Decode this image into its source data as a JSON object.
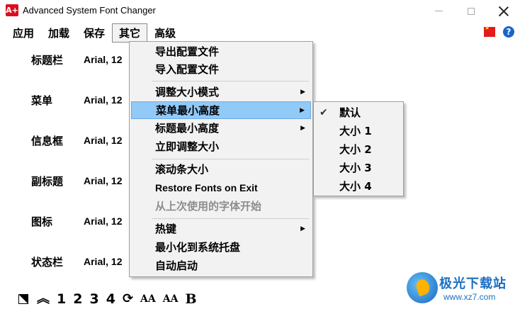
{
  "window": {
    "icon_text": "A+",
    "title": "Advanced System Font Changer"
  },
  "menubar": {
    "items": [
      "应用",
      "加载",
      "保存",
      "其它",
      "高级"
    ],
    "active_item": "其它",
    "flag_icon": "china-flag-icon",
    "help_icon_text": "?"
  },
  "settings": [
    {
      "label": "标题栏",
      "value": "Arial, 12"
    },
    {
      "label": "菜单",
      "value": "Arial, 12"
    },
    {
      "label": "信息框",
      "value": "Arial, 12"
    },
    {
      "label": "副标题",
      "value": "Arial, 12"
    },
    {
      "label": "图标",
      "value": "Arial, 12"
    },
    {
      "label": "状态栏",
      "value": "Arial, 12"
    }
  ],
  "dropdown": {
    "items": [
      {
        "label": "导出配置文件"
      },
      {
        "label": "导入配置文件"
      },
      {
        "label": "调整大小模式",
        "submenu": true
      },
      {
        "label": "菜单最小高度",
        "submenu": true,
        "highlighted": true
      },
      {
        "label": "标题最小高度",
        "submenu": true
      },
      {
        "label": "立即调整大小"
      },
      {
        "label": "滚动条大小"
      },
      {
        "label": "Restore Fonts on Exit"
      },
      {
        "label": "从上次使用的字体开始",
        "disabled": true
      },
      {
        "label": "热键",
        "submenu": true
      },
      {
        "label": "最小化到系统托盘"
      },
      {
        "label": "自动启动"
      }
    ]
  },
  "submenu": {
    "items": [
      {
        "label": "默认",
        "checked": true
      },
      {
        "label": "大小 1"
      },
      {
        "label": "大小 2"
      },
      {
        "label": "大小 3"
      },
      {
        "label": "大小 4"
      }
    ]
  },
  "toolbar": {
    "buttons": [
      "1",
      "2",
      "3",
      "4"
    ],
    "aa_large": "AA",
    "aa_small": "AA",
    "bold": "B",
    "up_arrows": "︽",
    "refresh": "⟳"
  },
  "watermark": {
    "title": "极光下载站",
    "url": "www.xz7.com"
  }
}
